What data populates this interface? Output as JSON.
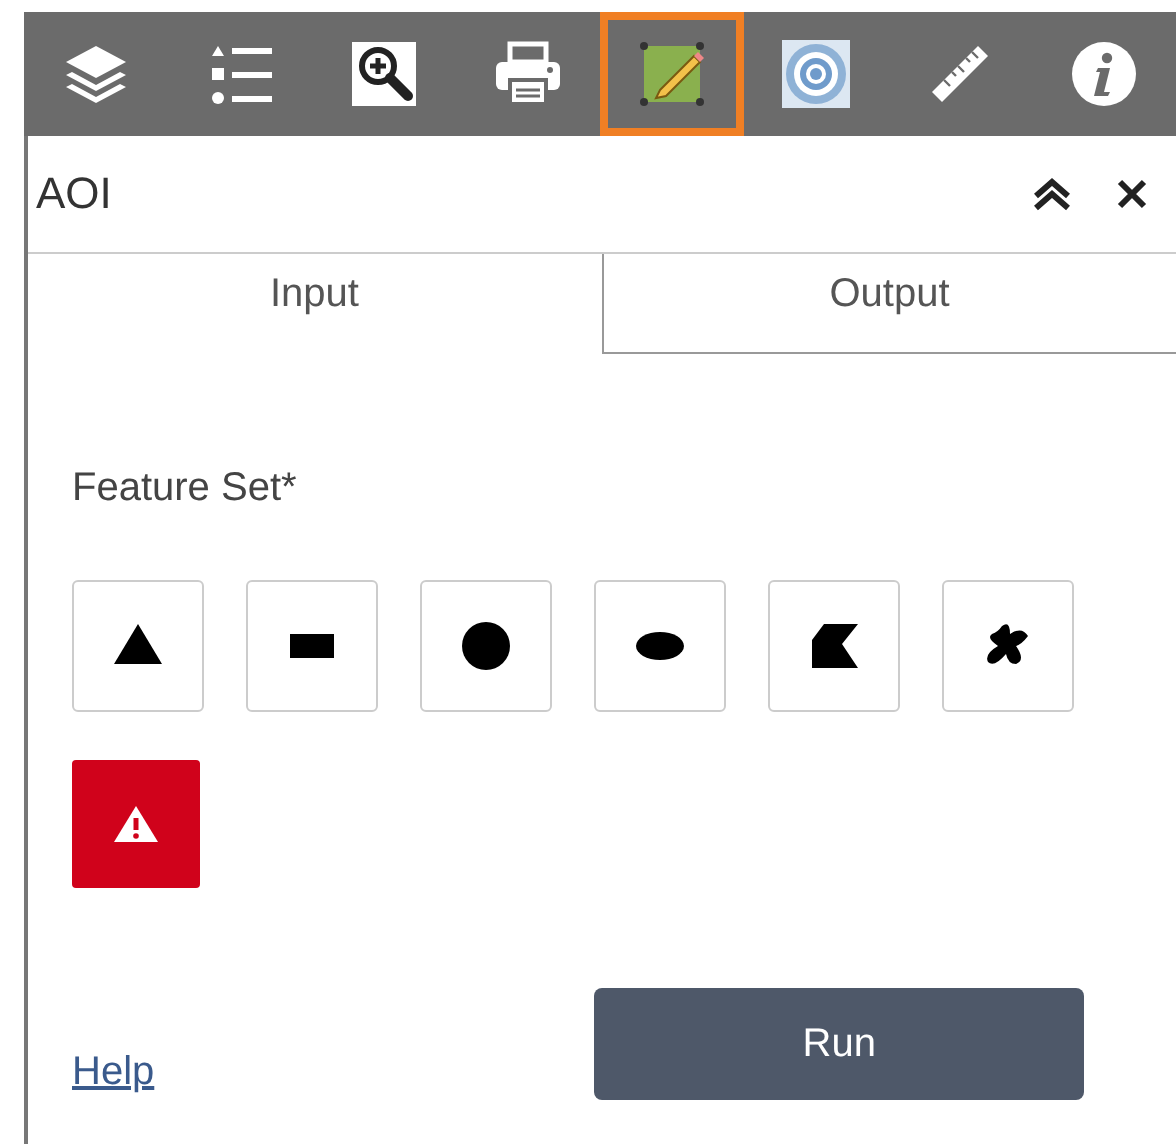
{
  "toolbar": {
    "tools": [
      {
        "kind": "layers",
        "selected": false
      },
      {
        "kind": "legend",
        "selected": false
      },
      {
        "kind": "zoom",
        "selected": false
      },
      {
        "kind": "print",
        "selected": false
      },
      {
        "kind": "draw",
        "selected": true
      },
      {
        "kind": "target",
        "selected": false
      },
      {
        "kind": "measure",
        "selected": false
      },
      {
        "kind": "info",
        "selected": false
      }
    ]
  },
  "panel": {
    "title": "AOI",
    "tabs": [
      {
        "label": "Input",
        "selected": true
      },
      {
        "label": "Output",
        "selected": false
      }
    ],
    "field_label": "Feature Set*",
    "draw_tools": [
      {
        "kind": "point"
      },
      {
        "kind": "rectangle"
      },
      {
        "kind": "circle"
      },
      {
        "kind": "ellipse"
      },
      {
        "kind": "polygon"
      },
      {
        "kind": "freehand"
      }
    ],
    "clear_button": {
      "kind": "warning"
    },
    "help_link": "Help",
    "run_button": "Run"
  }
}
